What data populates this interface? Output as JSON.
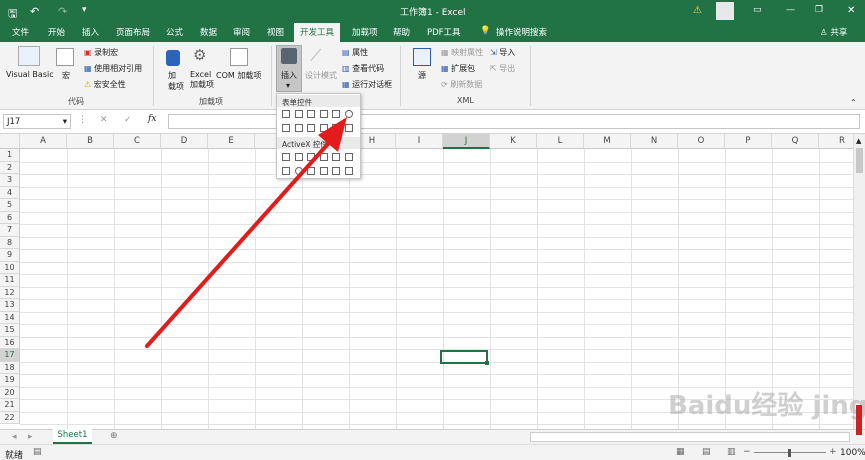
{
  "window": {
    "title": "工作簿1 - Excel",
    "share": "共享"
  },
  "tabs": [
    "文件",
    "开始",
    "插入",
    "页面布局",
    "公式",
    "数据",
    "审阅",
    "视图",
    "开发工具",
    "加载项",
    "帮助",
    "PDF工具"
  ],
  "active_tab": "开发工具",
  "search_hint": "操作说明搜索",
  "ribbon": {
    "code": {
      "visual_basic": "Visual Basic",
      "macros": "宏",
      "record_macro": "录制宏",
      "relative_ref": "使用相对引用",
      "macro_security": "宏安全性",
      "group": "代码"
    },
    "addins": {
      "addin": "加\n载项",
      "excel_addin_1": "Excel",
      "excel_addin_2": "加载项",
      "com_addin": "COM 加载项",
      "group": "加载项"
    },
    "controls": {
      "insert": "插入",
      "design_mode": "设计模式",
      "properties": "属性",
      "view_code": "查看代码",
      "run_dialog": "运行对话框"
    },
    "xml": {
      "source": "源",
      "map_props": "映射属性",
      "expansion": "扩展包",
      "refresh": "刷新数据",
      "import": "导入",
      "export": "导出",
      "group": "XML"
    }
  },
  "popup": {
    "form_controls": "表单控件",
    "activex_controls": "ActiveX 控件"
  },
  "formula_bar": {
    "name_box": "J17",
    "fx": "fx",
    "value": ""
  },
  "columns": [
    "A",
    "B",
    "C",
    "D",
    "E",
    "F",
    "G",
    "H",
    "I",
    "J",
    "K",
    "L",
    "M",
    "N",
    "O",
    "P",
    "Q",
    "R"
  ],
  "rows": [
    "1",
    "2",
    "3",
    "4",
    "5",
    "6",
    "7",
    "8",
    "9",
    "10",
    "11",
    "12",
    "13",
    "14",
    "15",
    "16",
    "17",
    "18",
    "19",
    "20",
    "21",
    "22"
  ],
  "selected_cell": "J17",
  "sheets": [
    "Sheet1"
  ],
  "status": {
    "mode": "就绪",
    "zoom": "100%"
  },
  "watermark": "Baidu经验 jingyan.baidu.com",
  "colors": {
    "brand": "#217346",
    "arrow": "#e31b1b"
  }
}
